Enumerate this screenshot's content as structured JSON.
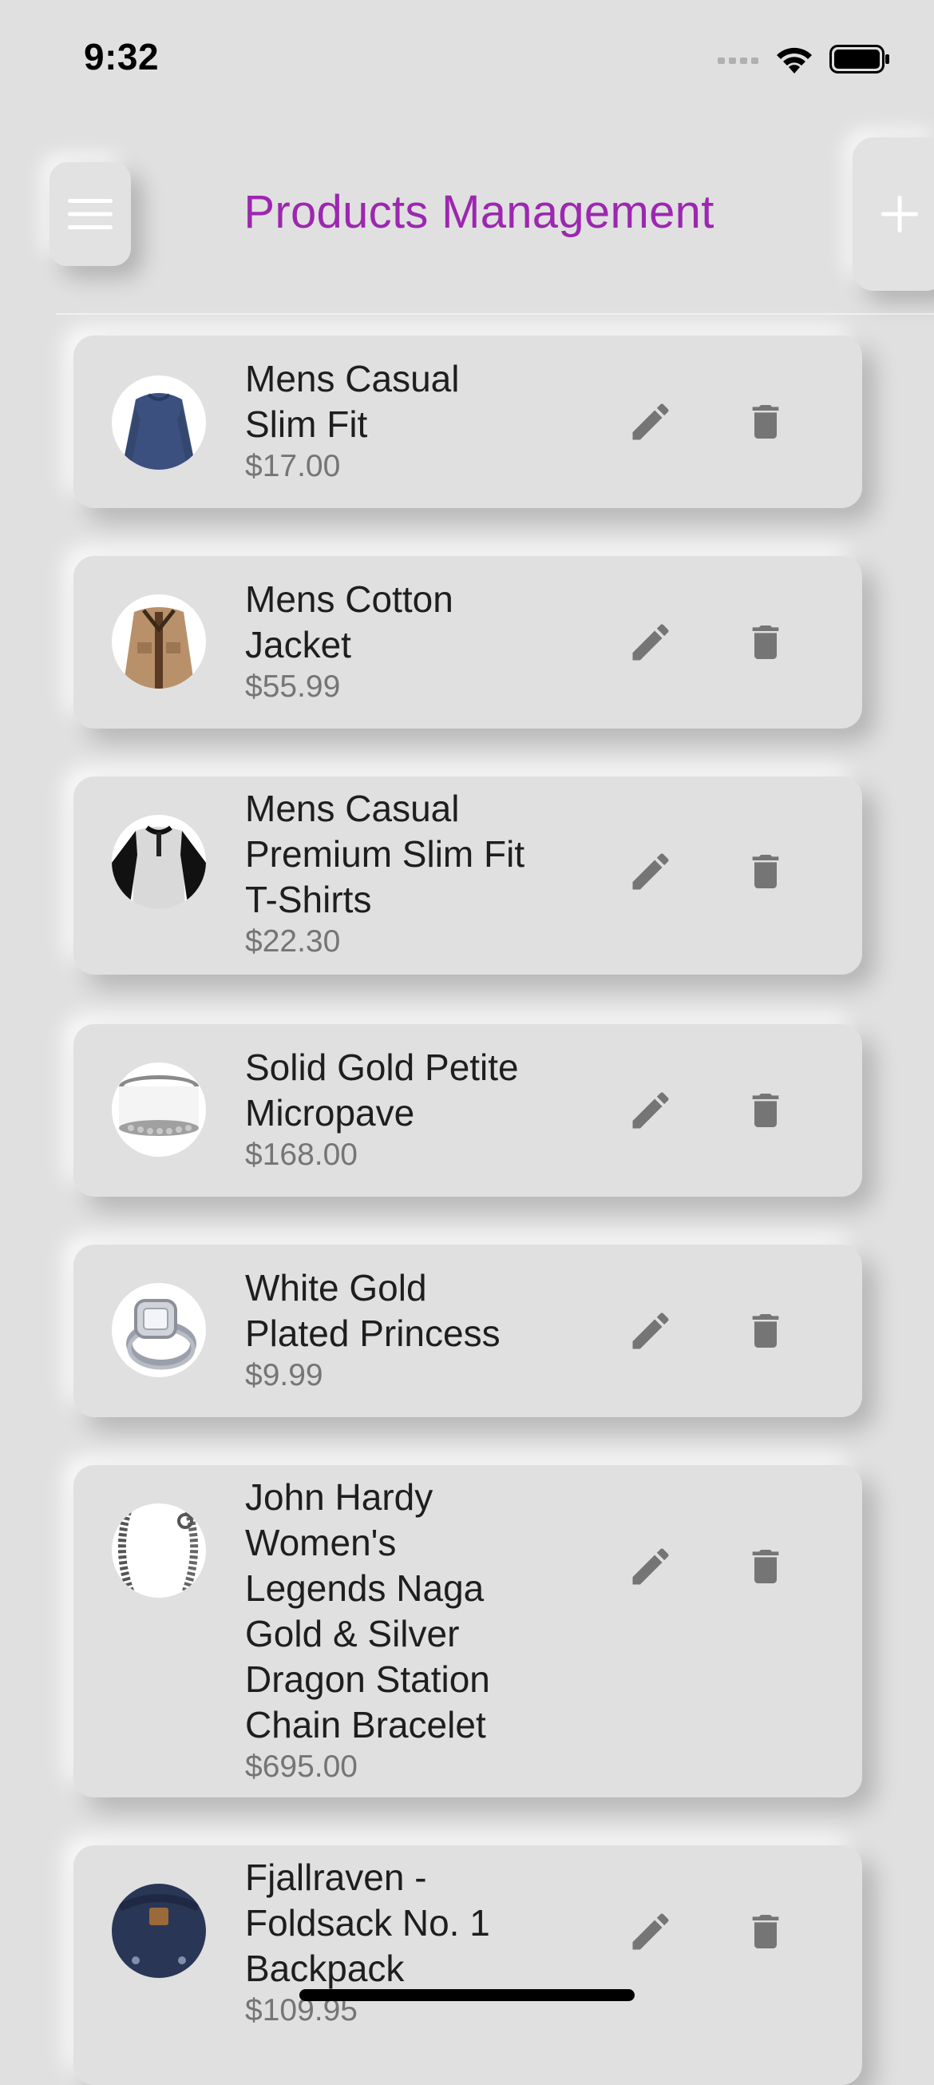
{
  "status_bar": {
    "time": "9:32"
  },
  "header": {
    "title": "Products Management",
    "menu_icon": "menu-icon",
    "add_icon": "plus-icon"
  },
  "colors": {
    "background": "#e0e0e0",
    "title": "#9c27b0",
    "icon": "#757575",
    "price": "#757575"
  },
  "products": [
    {
      "title_lines": [
        "Mens Casual",
        "Slim Fit"
      ],
      "price": "$17.00"
    },
    {
      "title_lines": [
        "Mens Cotton",
        "Jacket"
      ],
      "price": "$55.99"
    },
    {
      "title_lines": [
        "Mens Casual",
        "Premium Slim Fit",
        "T-Shirts"
      ],
      "price": "$22.30"
    },
    {
      "title_lines": [
        "Solid Gold Petite",
        "Micropave"
      ],
      "price": "$168.00"
    },
    {
      "title_lines": [
        "White Gold",
        "Plated Princess"
      ],
      "price": "$9.99"
    },
    {
      "title_lines": [
        "John Hardy",
        "Women's",
        "Legends Naga",
        "Gold & Silver",
        "Dragon Station",
        "Chain Bracelet"
      ],
      "price": "$695.00"
    },
    {
      "title_lines": [
        "Fjallraven -",
        "Foldsack No. 1",
        "Backpack"
      ],
      "price": "$109.95"
    }
  ],
  "row_icons": {
    "edit": "pencil-icon",
    "delete": "trash-icon"
  }
}
